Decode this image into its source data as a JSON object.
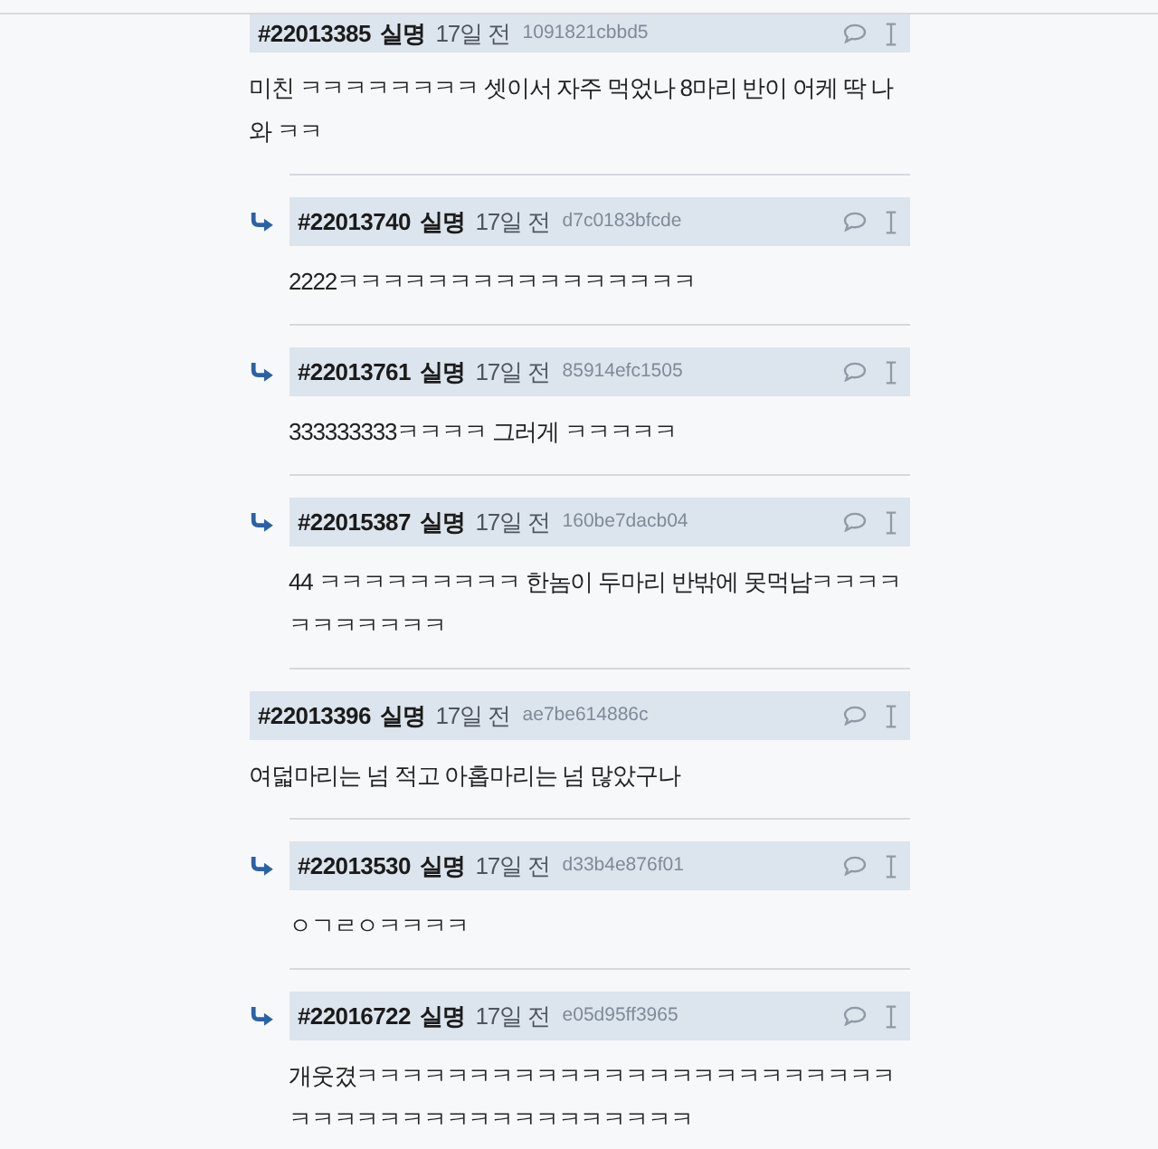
{
  "comments": [
    {
      "number": "#22013385",
      "author": "실명",
      "time": "17일 전",
      "hash": "1091821cbbd5",
      "text": "미친 ㅋㅋㅋㅋㅋㅋㅋㅋ 셋이서 자주 먹었나 8마리 반이 어케 딱 나와 ㅋㅋ",
      "children": [
        {
          "number": "#22013740",
          "author": "실명",
          "time": "17일 전",
          "hash": "d7c0183bfcde",
          "text": "2222ㅋㅋㅋㅋㅋㅋㅋㅋㅋㅋㅋㅋㅋㅋㅋㅋ"
        },
        {
          "number": "#22013761",
          "author": "실명",
          "time": "17일 전",
          "hash": "85914efc1505",
          "text": "333333333ㅋㅋㅋㅋ 그러게 ㅋㅋㅋㅋㅋ"
        },
        {
          "number": "#22015387",
          "author": "실명",
          "time": "17일 전",
          "hash": "160be7dacb04",
          "text": "44 ㅋㅋㅋㅋㅋㅋㅋㅋㅋ 한놈이 두마리 반밖에 못먹남ㅋㅋㅋㅋㅋㅋㅋㅋㅋㅋㅋ"
        }
      ]
    },
    {
      "number": "#22013396",
      "author": "실명",
      "time": "17일 전",
      "hash": "ae7be614886c",
      "text": "여덟마리는 넘 적고 아홉마리는 넘 많았구나",
      "children": [
        {
          "number": "#22013530",
          "author": "실명",
          "time": "17일 전",
          "hash": "d33b4e876f01",
          "text": "ㅇㄱㄹㅇㅋㅋㅋㅋ"
        },
        {
          "number": "#22016722",
          "author": "실명",
          "time": "17일 전",
          "hash": "e05d95ff3965",
          "text": "개웃겼ㅋㅋㅋㅋㅋㅋㅋㅋㅋㅋㅋㅋㅋㅋㅋㅋㅋㅋㅋㅋㅋㅋㅋㅋㅋㅋㅋㅋㅋㅋㅋㅋㅋㅋㅋㅋㅋㅋㅋㅋㅋㅋ"
        }
      ]
    }
  ]
}
